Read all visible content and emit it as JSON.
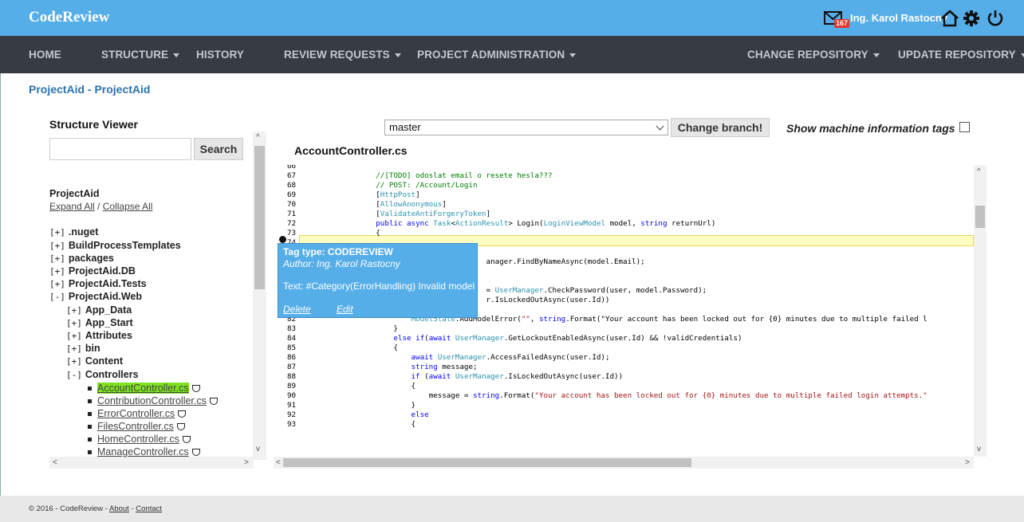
{
  "brand": "CodeReview",
  "user": {
    "name": "Ing. Karol Rastocny",
    "mail_count": "167"
  },
  "nav": {
    "home": "HOME",
    "structure": "STRUCTURE",
    "history": "HISTORY",
    "review_requests": "REVIEW REQUESTS",
    "project_admin": "PROJECT ADMINISTRATION",
    "change_repo": "CHANGE REPOSITORY",
    "update_repo": "UPDATE REPOSITORY"
  },
  "breadcrumb": "ProjectAid - ProjectAid",
  "structure_viewer": {
    "title": "Structure Viewer",
    "search_value": "",
    "search_button": "Search",
    "project": "ProjectAid",
    "expand_all": "Expand All",
    "separator": " / ",
    "collapse_all": "Collapse All",
    "tree": [
      {
        "toggle": "[+]",
        "label": ".nuget"
      },
      {
        "toggle": "[+]",
        "label": "BuildProcessTemplates"
      },
      {
        "toggle": "[+]",
        "label": "packages"
      },
      {
        "toggle": "[+]",
        "label": "ProjectAid.DB"
      },
      {
        "toggle": "[+]",
        "label": "ProjectAid.Tests"
      },
      {
        "toggle": "[-]",
        "label": "ProjectAid.Web"
      },
      {
        "toggle": "[+]",
        "label": "App_Data"
      },
      {
        "toggle": "[+]",
        "label": "App_Start"
      },
      {
        "toggle": "[+]",
        "label": "Attributes"
      },
      {
        "toggle": "[+]",
        "label": "bin"
      },
      {
        "toggle": "[+]",
        "label": "Content"
      },
      {
        "toggle": "[-]",
        "label": "Controllers"
      }
    ],
    "files": [
      "AccountController.cs",
      "ContributionController.cs",
      "ErrorController.cs",
      "FilesController.cs",
      "HomeController.cs",
      "ManageController.cs"
    ]
  },
  "branch": {
    "selected": "master",
    "change_button": "Change branch!"
  },
  "machine_tags_label": "Show machine information tags",
  "file_title": "AccountController.cs",
  "tag_popup": {
    "type": "Tag type: CODEREVIEW",
    "author": "Author: Ing. Karol Rastocny",
    "text": "Text: #Category(ErrorHandling) Invalid model",
    "delete": "Delete",
    "edit": "Edit"
  },
  "code": {
    "lines": [
      {
        "n": "66",
        "t": ""
      },
      {
        "n": "67",
        "t": "        //[TODO] odoslat email o resete hesla???"
      },
      {
        "n": "68",
        "t": "        // POST: /Account/Login"
      },
      {
        "n": "69",
        "t": "        [HttpPost]"
      },
      {
        "n": "70",
        "t": "        [AllowAnonymous]"
      },
      {
        "n": "71",
        "t": "        [ValidateAntiForgeryToken]"
      },
      {
        "n": "72",
        "t": "        public async Task<ActionResult> Login(LoginViewModel model, string returnUrl)"
      },
      {
        "n": "73",
        "t": "        {"
      },
      {
        "n": "74",
        "t": ""
      },
      {
        "n": "75",
        "t": ""
      },
      {
        "n": "76",
        "t": "                                 anager.FindByNameAsync(model.Email);"
      },
      {
        "n": "77",
        "t": ""
      },
      {
        "n": "78",
        "t": ""
      },
      {
        "n": "79",
        "t": "                                 = UserManager.CheckPassword(user, model.Password);"
      },
      {
        "n": "80",
        "t": "                                 r.IsLockedOutAsync(user.Id))"
      },
      {
        "n": "81",
        "t": "            {"
      },
      {
        "n": "82",
        "t": "                ModelState.AddModelError(\"\", string.Format(\"Your account has been locked out for {0} minutes due to multiple failed l"
      },
      {
        "n": "83",
        "t": "            }"
      },
      {
        "n": "84",
        "t": "            else if(await UserManager.GetLockoutEnabledAsync(user.Id) && !validCredentials)"
      },
      {
        "n": "85",
        "t": "            {"
      },
      {
        "n": "86",
        "t": "                await UserManager.AccessFailedAsync(user.Id);"
      },
      {
        "n": "87",
        "t": "                string message;"
      },
      {
        "n": "88",
        "t": "                if (await UserManager.IsLockedOutAsync(user.Id))"
      },
      {
        "n": "89",
        "t": "                {"
      },
      {
        "n": "90",
        "t": "                    message = string.Format(\"Your account has been locked out for {0} minutes due to multiple failed login attempts.\""
      },
      {
        "n": "91",
        "t": "                }"
      },
      {
        "n": "92",
        "t": "                else"
      },
      {
        "n": "93",
        "t": "                {"
      }
    ]
  },
  "footer": {
    "copyright": "© 2016 - CodeReview - ",
    "about": "About",
    "dash": " - ",
    "contact": "Contact"
  }
}
